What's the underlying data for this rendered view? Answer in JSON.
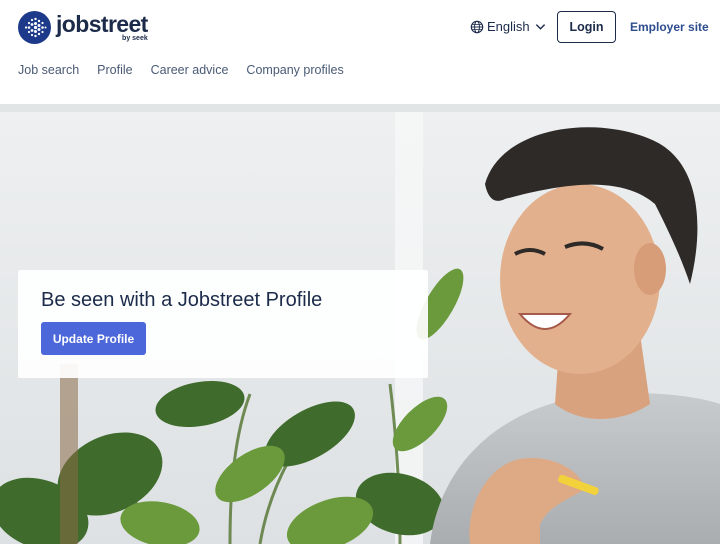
{
  "header": {
    "logo": {
      "wordmark": "jobstreet",
      "byline": "by seek"
    },
    "language": {
      "icon": "globe-icon",
      "label": "English",
      "chevron": "chevron-down-icon"
    },
    "login_label": "Login",
    "employer_label": "Employer site"
  },
  "nav": {
    "items": [
      {
        "label": "Job search"
      },
      {
        "label": "Profile"
      },
      {
        "label": "Career advice"
      },
      {
        "label": "Company profiles"
      }
    ]
  },
  "hero": {
    "title": "Be seen with a Jobstreet Profile",
    "cta_label": "Update Profile"
  },
  "colors": {
    "brand_navy": "#1c2b4a",
    "cta_blue": "#4c67d9",
    "logo_blue": "#1d3a8a"
  }
}
